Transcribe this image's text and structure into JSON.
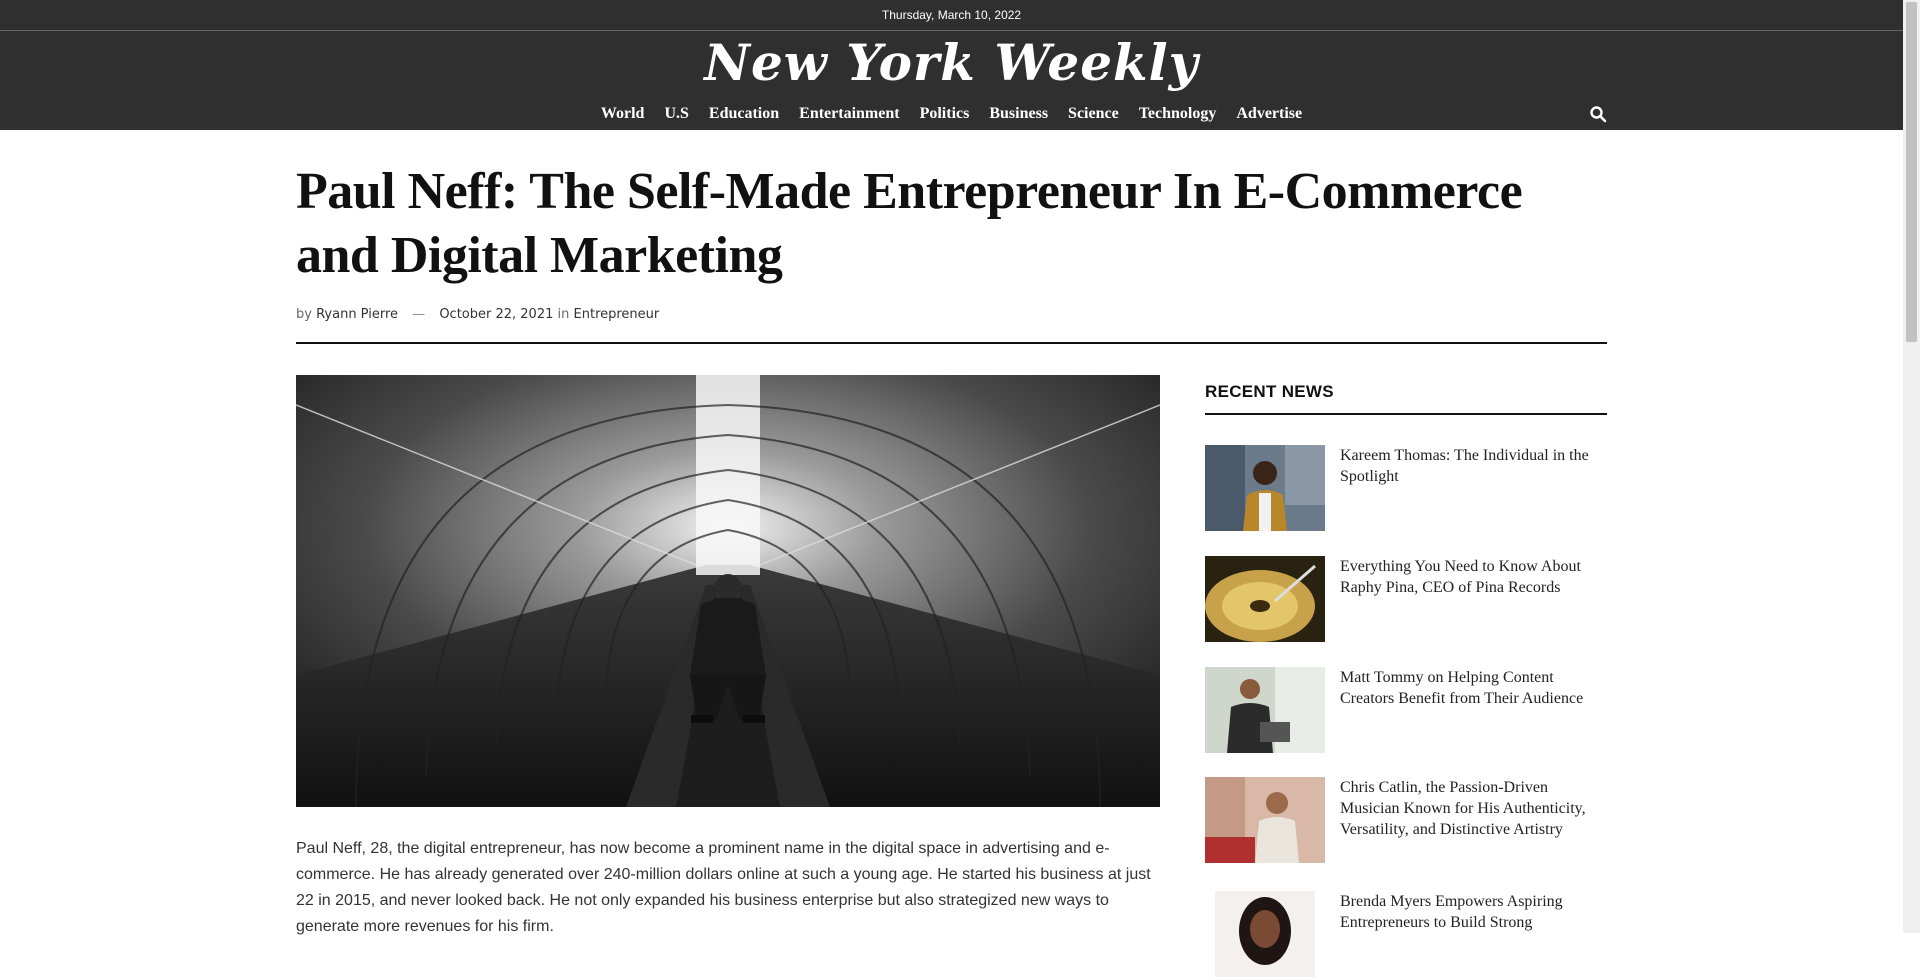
{
  "topbar": {
    "date": "Thursday, March 10, 2022"
  },
  "header": {
    "logo": "New York Weekly",
    "nav": [
      "World",
      "U.S",
      "Education",
      "Entertainment",
      "Politics",
      "Business",
      "Science",
      "Technology",
      "Advertise"
    ],
    "search_icon": "search-icon"
  },
  "article": {
    "title": "Paul Neff: The Self-Made Entrepreneur In E-Commerce and Digital Marketing",
    "by": "by",
    "author": "Ryann Pierre",
    "dash": "—",
    "date": "October 22, 2021",
    "in": "in",
    "category": "Entrepreneur",
    "body": "Paul Neff, 28, the digital entrepreneur, has now become a prominent name in the digital space in advertising and e-commerce. He has already generated over 240-million dollars online at such a young age. He started his business at just 22 in 2015, and never looked back. He not only expanded his business enterprise but also strategized new ways to generate more revenues for his firm."
  },
  "sidebar": {
    "heading": "RECENT NEWS",
    "items": [
      {
        "title": "Kareem Thomas: The Individual in the Spotlight"
      },
      {
        "title": "Everything You Need to Know About Raphy Pina, CEO of Pina Records"
      },
      {
        "title": "Matt Tommy on Helping Content Creators Benefit from Their Audience"
      },
      {
        "title": "Chris Catlin, the Passion-Driven Musician Known for His Authenticity, Versatility, and Distinctive Artistry"
      },
      {
        "title": "Brenda Myers Empowers Aspiring Entrepreneurs to Build Strong"
      }
    ]
  }
}
